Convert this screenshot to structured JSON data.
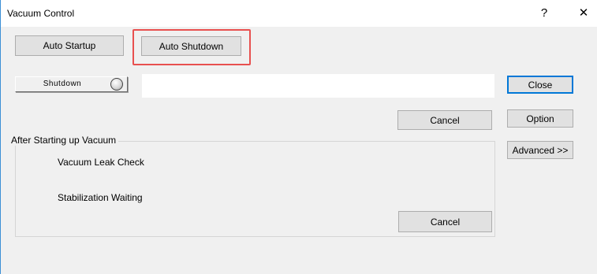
{
  "window": {
    "title": "Vacuum Control",
    "help_glyph": "?",
    "close_glyph": "✕"
  },
  "toolbar": {
    "auto_startup_label": "Auto Startup",
    "auto_shutdown_label": "Auto Shutdown"
  },
  "status": {
    "state_label": "Shutdown",
    "message": ""
  },
  "actions": {
    "cancel_label": "Cancel"
  },
  "side_buttons": {
    "close_label": "Close",
    "option_label": "Option",
    "advanced_label": "Advanced >>"
  },
  "after_startup": {
    "title": "After Starting up Vacuum",
    "items": [
      "Vacuum Leak Check",
      "Stabilization Waiting"
    ],
    "cancel_label": "Cancel"
  },
  "colors": {
    "highlight": "#e8504f",
    "default_button_border": "#0078d7",
    "window_border": "#3c8fd6"
  }
}
